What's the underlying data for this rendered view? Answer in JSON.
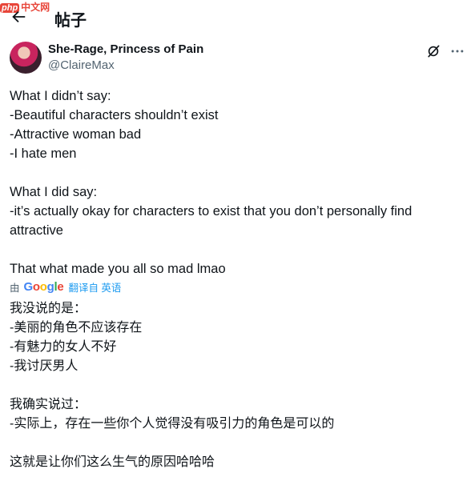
{
  "watermark": {
    "php": "php",
    "text": "中文网"
  },
  "header": {
    "title": "帖子"
  },
  "author": {
    "name": "She-Rage, Princess of Pain",
    "handle": "@ClaireMax"
  },
  "tweet": {
    "lines": [
      "What I didn’t say:",
      "-Beautiful characters shouldn’t exist",
      "-Attractive woman bad",
      "-I hate men",
      "",
      "What I did say:",
      "-it’s actually okay for characters to exist that you don’t personally find attractive",
      "",
      "That what made you all so mad lmao"
    ]
  },
  "translation": {
    "by": "由",
    "google": [
      "G",
      "o",
      "o",
      "g",
      "l",
      "e"
    ],
    "link": "翻译自 英语",
    "lines": [
      "我没说的是：",
      "-美丽的角色不应该存在",
      "-有魅力的女人不好",
      "-我讨厌男人",
      "",
      "我确实说过：",
      "-实际上，存在一些你个人觉得没有吸引力的角色是可以的",
      "",
      "这就是让你们这么生气的原因哈哈哈"
    ]
  },
  "colors": {
    "link": "#1d9bf0",
    "secondary": "#536471",
    "text": "#0f1419"
  },
  "icons": [
    "arrow-left-icon",
    "grok-icon",
    "more-horizontal-icon"
  ]
}
